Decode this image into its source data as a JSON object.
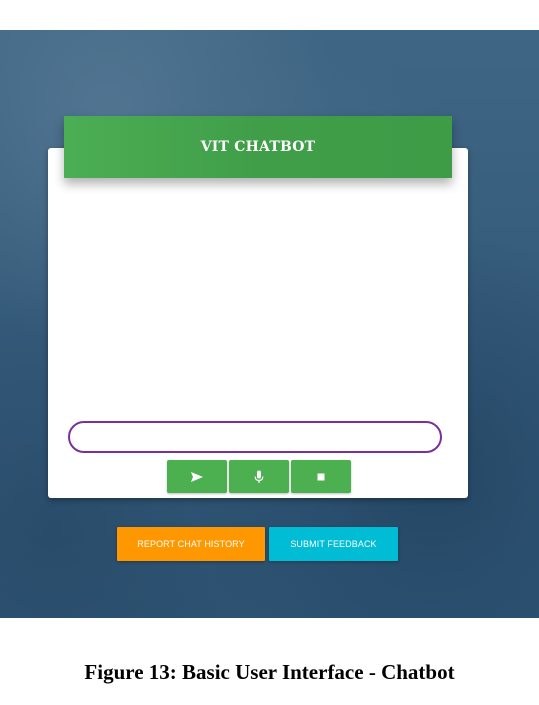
{
  "chatbot": {
    "title": "VIT CHATBOT",
    "input_value": "",
    "input_placeholder": "",
    "buttons": {
      "send_icon": "send-icon",
      "mic_icon": "microphone-icon",
      "stop_icon": "stop-icon"
    }
  },
  "actions": {
    "report_label": "REPORT CHAT HISTORY",
    "feedback_label": "SUBMIT FEEDBACK"
  },
  "caption": "Figure 13: Basic User Interface - Chatbot",
  "colors": {
    "header_green": "#43a047",
    "icon_button_green": "#4caf50",
    "input_border_purple": "#7b2f9c",
    "report_orange": "#ff9800",
    "feedback_cyan": "#00bcd4",
    "background_blue": "#355b7a"
  }
}
